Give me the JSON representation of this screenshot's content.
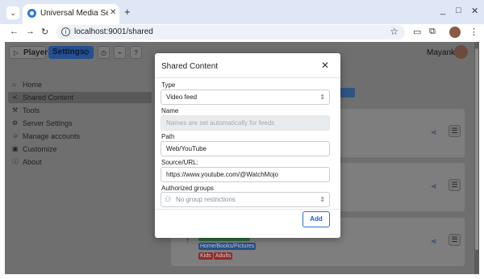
{
  "browser": {
    "tab_title": "Universal Media Server",
    "tab_close": "✕",
    "new_tab": "+",
    "url": "localhost:9001/shared",
    "window_controls": {
      "minimize": "_",
      "maximize": "□",
      "close": "✕"
    }
  },
  "toolbar": {
    "player_label": "Player",
    "settings_label": "Settings"
  },
  "user": {
    "name": "Mayank"
  },
  "sidebar": {
    "items": [
      {
        "label": "Home",
        "icon": "home-icon",
        "glyph": "⌂"
      },
      {
        "label": "Shared Content",
        "icon": "share-icon",
        "glyph": "≺"
      },
      {
        "label": "Tools",
        "icon": "tools-icon",
        "glyph": "⚒"
      },
      {
        "label": "Server Settings",
        "icon": "gear-icon",
        "glyph": "⚙"
      },
      {
        "label": "Manage accounts",
        "icon": "users-icon",
        "glyph": "☺"
      },
      {
        "label": "Customize",
        "icon": "customize-icon",
        "glyph": "▣"
      },
      {
        "label": "About",
        "icon": "info-icon",
        "glyph": "ⓘ"
      }
    ]
  },
  "background_card": {
    "tag_blue": "Home/Books/Pictures",
    "tag_red_1": "Kids",
    "tag_red_2": "Adults"
  },
  "modal": {
    "title": "Shared Content",
    "close": "✕",
    "type_label": "Type",
    "type_value": "Video feed",
    "name_label": "Name",
    "name_placeholder": "Names are set automatically for feeds",
    "path_label": "Path",
    "path_value": "Web/YouTube",
    "source_label": "Source/URL:",
    "source_value": "https://www.youtube.com/@WatchMojo",
    "groups_label": "Authorized groups",
    "groups_value": "No group restrictions",
    "add_label": "Add"
  },
  "colors": {
    "accent": "#2b6fd6",
    "settings_button": "#24508f",
    "overlay": "#6f6f6f",
    "tab_bar": "#dfe7f6"
  }
}
